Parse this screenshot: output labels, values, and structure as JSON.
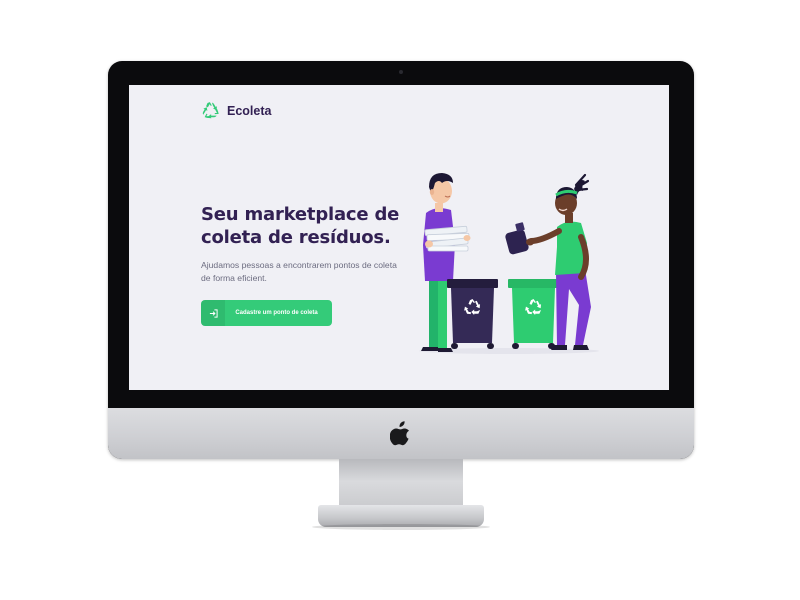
{
  "site": {
    "brand": "Ecoleta",
    "logo_icon": "recycle-icon",
    "hero_title": "Seu marketplace de coleta de resíduos.",
    "hero_subtitle": "Ajudamos pessoas a encontrarem pontos de coleta de forma eficient.",
    "cta_label": "Cadastre um ponto de coleta",
    "cta_icon": "sign-in-icon"
  },
  "device": {
    "type": "desktop-monitor",
    "chin_logo": "apple-logo-icon"
  },
  "colors": {
    "primary": "#34cb79",
    "title": "#322153",
    "text": "#6c6c80",
    "background": "#f0f0f5",
    "accent_purple": "#7a3bd1",
    "bin_dark": "#2a2245",
    "bin_green": "#2ecc71"
  }
}
